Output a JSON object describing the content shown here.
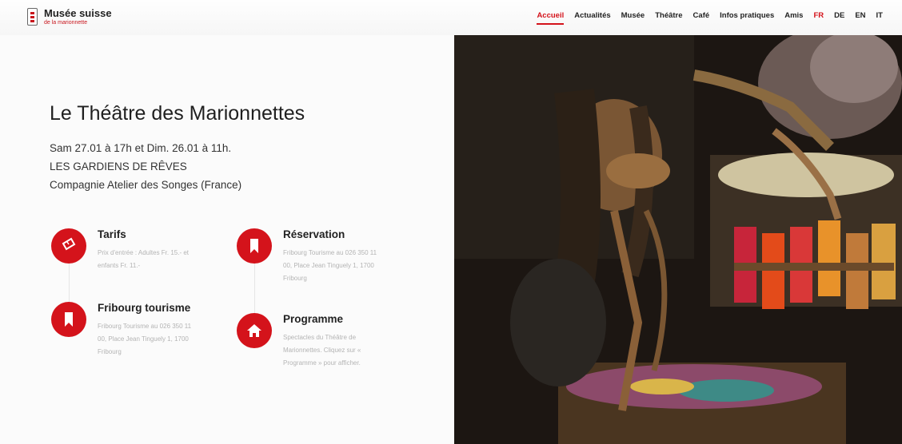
{
  "header": {
    "logo_title": "Musée suisse",
    "logo_subtitle": "de la marionnette",
    "nav": [
      "Accueil",
      "Actualités",
      "Musée",
      "Théâtre",
      "Café",
      "Infos pratiques",
      "Amis",
      "FR",
      "DE",
      "EN",
      "IT"
    ],
    "nav_active": "Accueil",
    "lang_active": "FR"
  },
  "main": {
    "title": "Le Théâtre des Marionnettes",
    "event_lines": [
      "Sam 27.01 à 17h et Dim. 26.01 à 11h.",
      "LES GARDIENS DE RÊVES",
      "Compagnie Atelier des Songes (France)"
    ]
  },
  "info": [
    {
      "icon": "ticket-icon",
      "title": "Tarifs",
      "text": "Prix d'entrée : Adultes Fr. 15.- et enfants Fr. 11.-"
    },
    {
      "icon": "bookmark-icon",
      "title": "Réservation",
      "text": "Fribourg Tourisme au 026 350 11 00, Place Jean Tinguely 1, 1700 Fribourg"
    },
    {
      "icon": "bookmark-icon",
      "title": "Fribourg tourisme",
      "text": "Fribourg Tourisme au 026 350 11 00, Place Jean Tinguely 1, 1700 Fribourg"
    },
    {
      "icon": "home-icon",
      "title": "Programme",
      "text": "Spectacles du Théâtre de Marionnettes. Cliquez sur « Programme » pour afficher."
    }
  ],
  "colors": {
    "accent": "#d4131b",
    "text": "#222222",
    "muted": "#b4b4b4"
  }
}
